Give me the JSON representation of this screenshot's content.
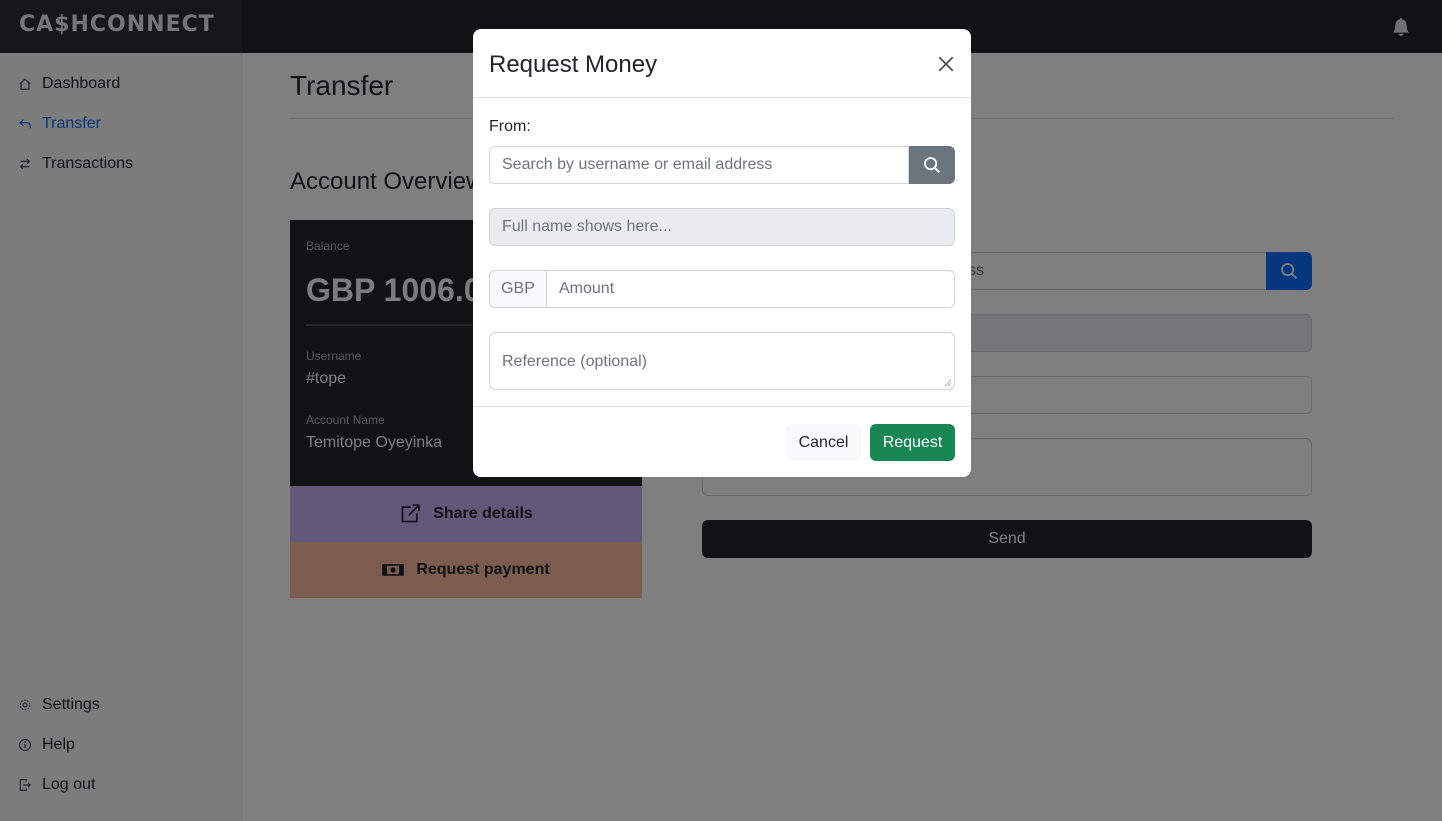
{
  "app": {
    "brand": "CA$HCONNECT"
  },
  "icons": {
    "notification": "bell-icon",
    "dashboard": "house-icon",
    "transfer": "reply-arrow-icon",
    "transactions": "swap-arrows-icon",
    "settings": "gear-icon",
    "help": "info-icon",
    "logout": "exit-icon",
    "share": "external-link-icon",
    "request_payment": "cash-icon",
    "search": "search-icon",
    "close": "close-icon"
  },
  "sidebar": {
    "items": [
      {
        "label": "Dashboard"
      },
      {
        "label": "Transfer"
      },
      {
        "label": "Transactions"
      }
    ],
    "bottom_items": [
      {
        "label": "Settings"
      },
      {
        "label": "Help"
      },
      {
        "label": "Log out"
      }
    ]
  },
  "main": {
    "title": "Transfer",
    "overview_title": "Account Overview",
    "card": {
      "balance_label": "Balance",
      "balance_value": "GBP 1006.0",
      "username_label": "Username",
      "username_value": "#tope",
      "account_name_label": "Account Name",
      "account_name_value": "Temitope Oyeyinka"
    },
    "share_label": "Share details",
    "request_payment_label": "Request payment",
    "form": {
      "visible_placeholder_fragment": "ss",
      "send_label": "Send"
    }
  },
  "modal": {
    "title": "Request Money",
    "from_label": "From:",
    "search_placeholder": "Search by username or email address",
    "fullname_placeholder": "Full name shows here...",
    "currency": "GBP",
    "amount_placeholder": "Amount",
    "reference_placeholder": "Reference (optional)",
    "cancel_label": "Cancel",
    "request_label": "Request"
  },
  "colors": {
    "topbar": "#212529",
    "primary": "#0d6efd",
    "success": "#198754",
    "share_bg": "#c5b3f5",
    "request_bg": "#f7b89c"
  }
}
